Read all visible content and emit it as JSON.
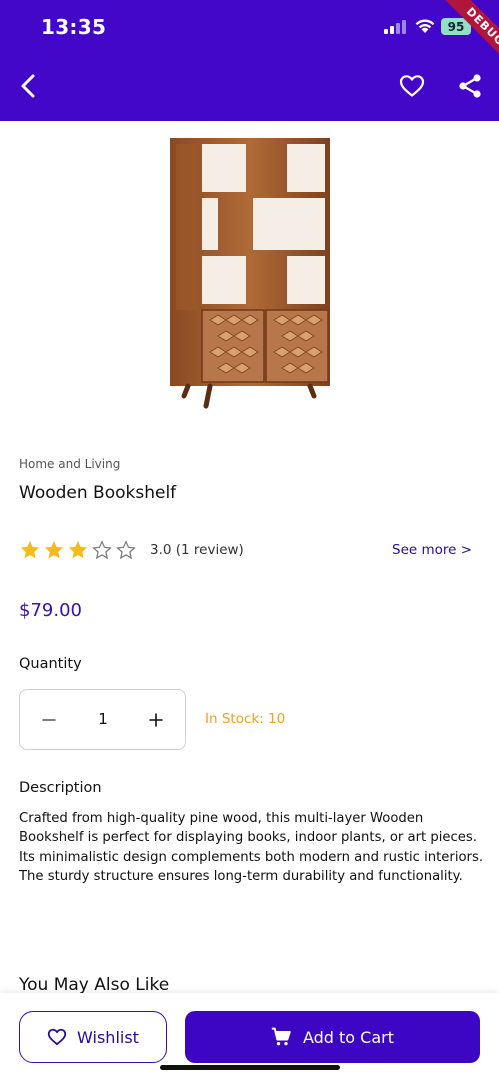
{
  "status_bar": {
    "time": "13:35",
    "battery": "95",
    "debug_label": "DEBUG"
  },
  "top_bar": {
    "back_icon": "chevron-left-icon",
    "wishlist_icon": "heart-outline-icon",
    "share_icon": "share-icon"
  },
  "product": {
    "category": "Home and Living",
    "title": "Wooden Bookshelf",
    "rating": 3,
    "rating_max": 5,
    "rating_text": "3.0 (1 review)",
    "see_more": "See more >",
    "price": "$79.00"
  },
  "quantity": {
    "label": "Quantity",
    "value": "1",
    "stock": "In Stock: 10"
  },
  "description": {
    "title": "Description",
    "text": "Crafted from high-quality pine wood, this multi-layer Wooden Bookshelf is perfect for displaying books, indoor plants, or art pieces. Its minimalistic design complements both modern and rustic interiors. The sturdy structure ensures long-term durability and functionality."
  },
  "related": {
    "title": "You May Also Like"
  },
  "actions": {
    "wishlist_label": "Wishlist",
    "cart_label": "Add to Cart"
  },
  "colors": {
    "brand": "#4207c8",
    "accent": "#3a0fb0",
    "stock": "#f0a01c",
    "star": "#f6bb1a"
  }
}
